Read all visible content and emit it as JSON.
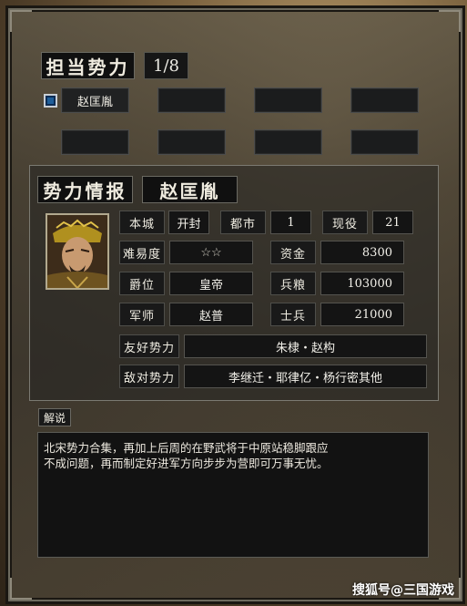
{
  "header": {
    "title": "担当势力",
    "count": "1/8"
  },
  "faction_slots": [
    {
      "label": "赵匡胤",
      "selected": true
    },
    {
      "label": ""
    },
    {
      "label": ""
    },
    {
      "label": ""
    },
    {
      "label": ""
    },
    {
      "label": ""
    },
    {
      "label": ""
    },
    {
      "label": ""
    }
  ],
  "info": {
    "title": "势力情报",
    "ruler": "赵匡胤",
    "base_city_label": "本城",
    "base_city_value": "开封",
    "cities_label": "都市",
    "cities_value": "1",
    "active_label": "现役",
    "active_value": "21",
    "difficulty_label": "难易度",
    "difficulty_value": "☆☆",
    "funds_label": "资金",
    "funds_value": "8300",
    "rank_label": "爵位",
    "rank_value": "皇帝",
    "food_label": "兵粮",
    "food_value": "103000",
    "advisor_label": "军师",
    "advisor_value": "赵普",
    "troops_label": "士兵",
    "troops_value": "21000",
    "friendly_label": "友好势力",
    "friendly_value": "朱棣・赵构",
    "hostile_label": "敌对势力",
    "hostile_value": "李继迁・耶律亿・杨行密其他"
  },
  "description": {
    "tag": "解说",
    "text": "北宋势力合集，再加上后周的在野武将于中原站稳脚跟应\n不成问题，再而制定好进军方向步步为营即可万事无忧。"
  },
  "watermark": "搜狐号@三国游戏"
}
